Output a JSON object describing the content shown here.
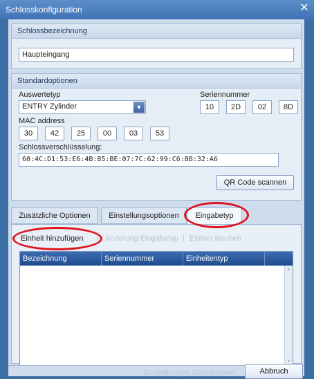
{
  "window": {
    "title": "Schlosskonfiguration",
    "close_glyph": "✕"
  },
  "lock_name": {
    "header": "Schlossbezeichnung",
    "value": "Haupteingang"
  },
  "defaults": {
    "header": "Standardoptionen",
    "eval_type_label": "Auswertetyp",
    "eval_type_value": "ENTRY Zylinder",
    "serial_label": "Seriennummer",
    "serial": [
      "10",
      "2D",
      "02",
      "8D"
    ],
    "mac_label": "MAC address",
    "mac": [
      "30",
      "42",
      "25",
      "00",
      "03",
      "53"
    ],
    "encryption_label": "Schlossverschlüsselung:",
    "encryption_value": "60:4C:D1:53:E6:4B:85:BE:07:7C:62:99:C6:8B:32:A6",
    "qr_button": "QR Code scannen"
  },
  "tabs": [
    "Zusätzliche Optionen",
    "Einstellungsoptionen",
    "Eingabetyp"
  ],
  "toolbar": {
    "add_unit": "Einheit hinzufügen",
    "change_type": "Änderung Eingabetyp",
    "delete_unit": "Einheit löschen"
  },
  "grid": {
    "columns": [
      "Bezeichnung",
      "Seriennummer",
      "Einheitentyp"
    ]
  },
  "footer": {
    "faded_label": "Einstellungen übernehmen",
    "cancel": "Abbruch"
  },
  "colors": {
    "highlight": "#e0141f",
    "titlebar": "#4a7fbf",
    "grid_header": "#2b5799"
  }
}
